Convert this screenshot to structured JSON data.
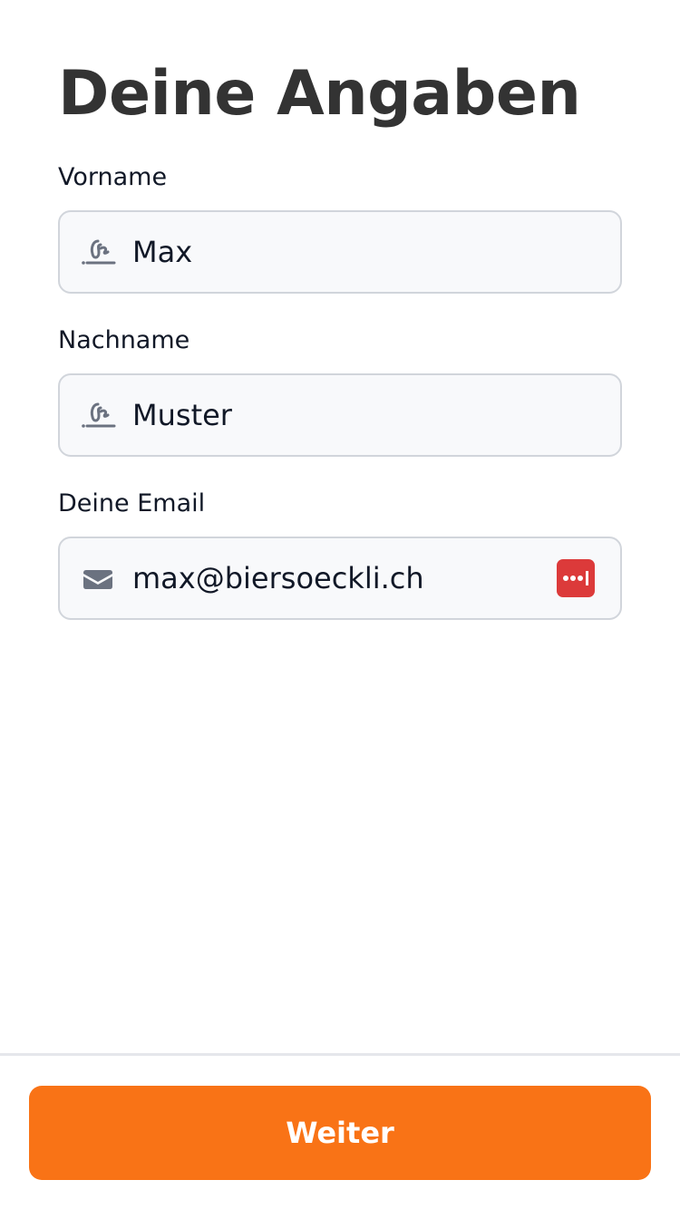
{
  "page": {
    "title": "Deine Angaben"
  },
  "form": {
    "first_name": {
      "label": "Vorname",
      "value": "Max",
      "icon": "signature-icon"
    },
    "last_name": {
      "label": "Nachname",
      "value": "Muster",
      "icon": "signature-icon"
    },
    "email": {
      "label": "Deine Email",
      "value": "max@biersoeckli.ch",
      "icon": "envelope-icon",
      "trailing_icon": "password-manager-icon"
    }
  },
  "footer": {
    "next_label": "Weiter"
  },
  "colors": {
    "accent": "#f97316",
    "title": "#333333",
    "field_bg": "#f8f9fb",
    "field_border": "#d1d5db",
    "icon": "#6b7280",
    "password_manager": "#dc3a3a"
  }
}
